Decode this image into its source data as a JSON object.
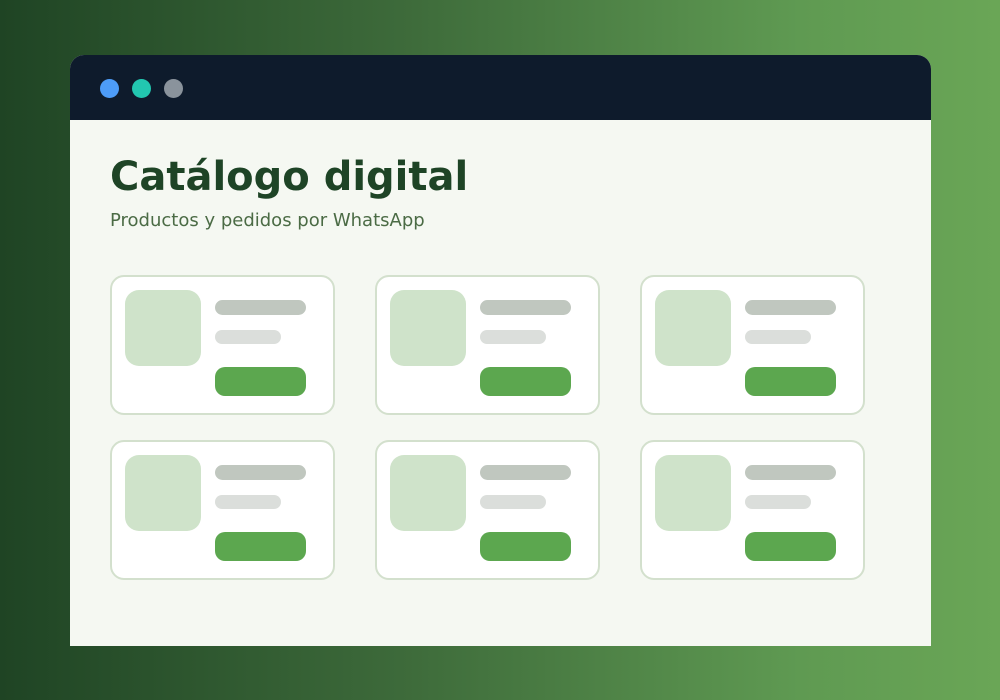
{
  "window": {
    "controls": [
      {
        "name": "window-dot-blue",
        "color": "#4d9cf8"
      },
      {
        "name": "window-dot-teal",
        "color": "#22c7b0"
      },
      {
        "name": "window-dot-gray",
        "color": "#8a939c"
      }
    ]
  },
  "page": {
    "title": "Catálogo digital",
    "subtitle": "Productos y pedidos por WhatsApp"
  },
  "catalog": {
    "product_cards": 6,
    "colors": {
      "thumbnail": "#cfe3ca",
      "name_placeholder": "#c0c7bf",
      "price_placeholder": "#dbdedb",
      "order_button": "#5ca74f"
    }
  }
}
